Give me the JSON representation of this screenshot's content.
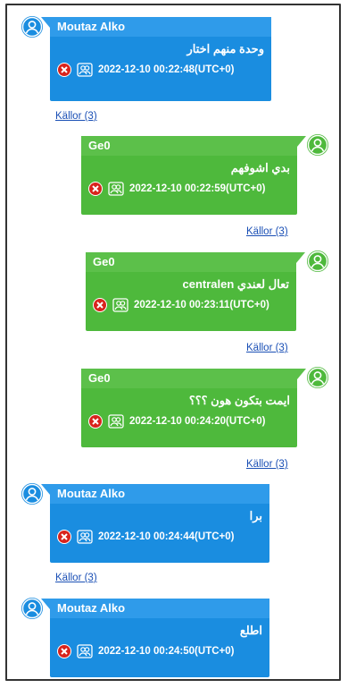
{
  "colors": {
    "incoming_bubble": "#1a8de0",
    "outgoing_bubble": "#4eb93c",
    "link": "#1a4fb5",
    "avatar_blue": "#1a8de0",
    "avatar_green": "#4eb93c"
  },
  "messages": [
    {
      "sender": "Moutaz Alko",
      "text": "وحدة منهم اختار",
      "timestamp": "2022-12-10 00:22:48(UTC+0)",
      "sources": "Källor (3)",
      "direction": "incoming"
    },
    {
      "sender": "Ge0",
      "text": "بدي اشوفهم",
      "timestamp": "2022-12-10 00:22:59(UTC+0)",
      "sources": "Källor (3)",
      "direction": "outgoing"
    },
    {
      "sender": "Ge0",
      "text": "تعال لعندي centralen",
      "timestamp": "2022-12-10 00:23:11(UTC+0)",
      "sources": "Källor (3)",
      "direction": "outgoing"
    },
    {
      "sender": "Ge0",
      "text": "ايمت بتكون هون ؟؟؟",
      "timestamp": "2022-12-10 00:24:20(UTC+0)",
      "sources": "Källor (3)",
      "direction": "outgoing"
    },
    {
      "sender": "Moutaz Alko",
      "text": "برا",
      "timestamp": "2022-12-10 00:24:44(UTC+0)",
      "sources": "Källor (3)",
      "direction": "incoming"
    },
    {
      "sender": "Moutaz Alko",
      "text": "اطلع",
      "timestamp": "2022-12-10 00:24:50(UTC+0)",
      "sources": "",
      "direction": "incoming"
    }
  ],
  "icons": {
    "avatar": "user-avatar-icon",
    "status": "delete-x-icon",
    "participants": "group-icon"
  }
}
